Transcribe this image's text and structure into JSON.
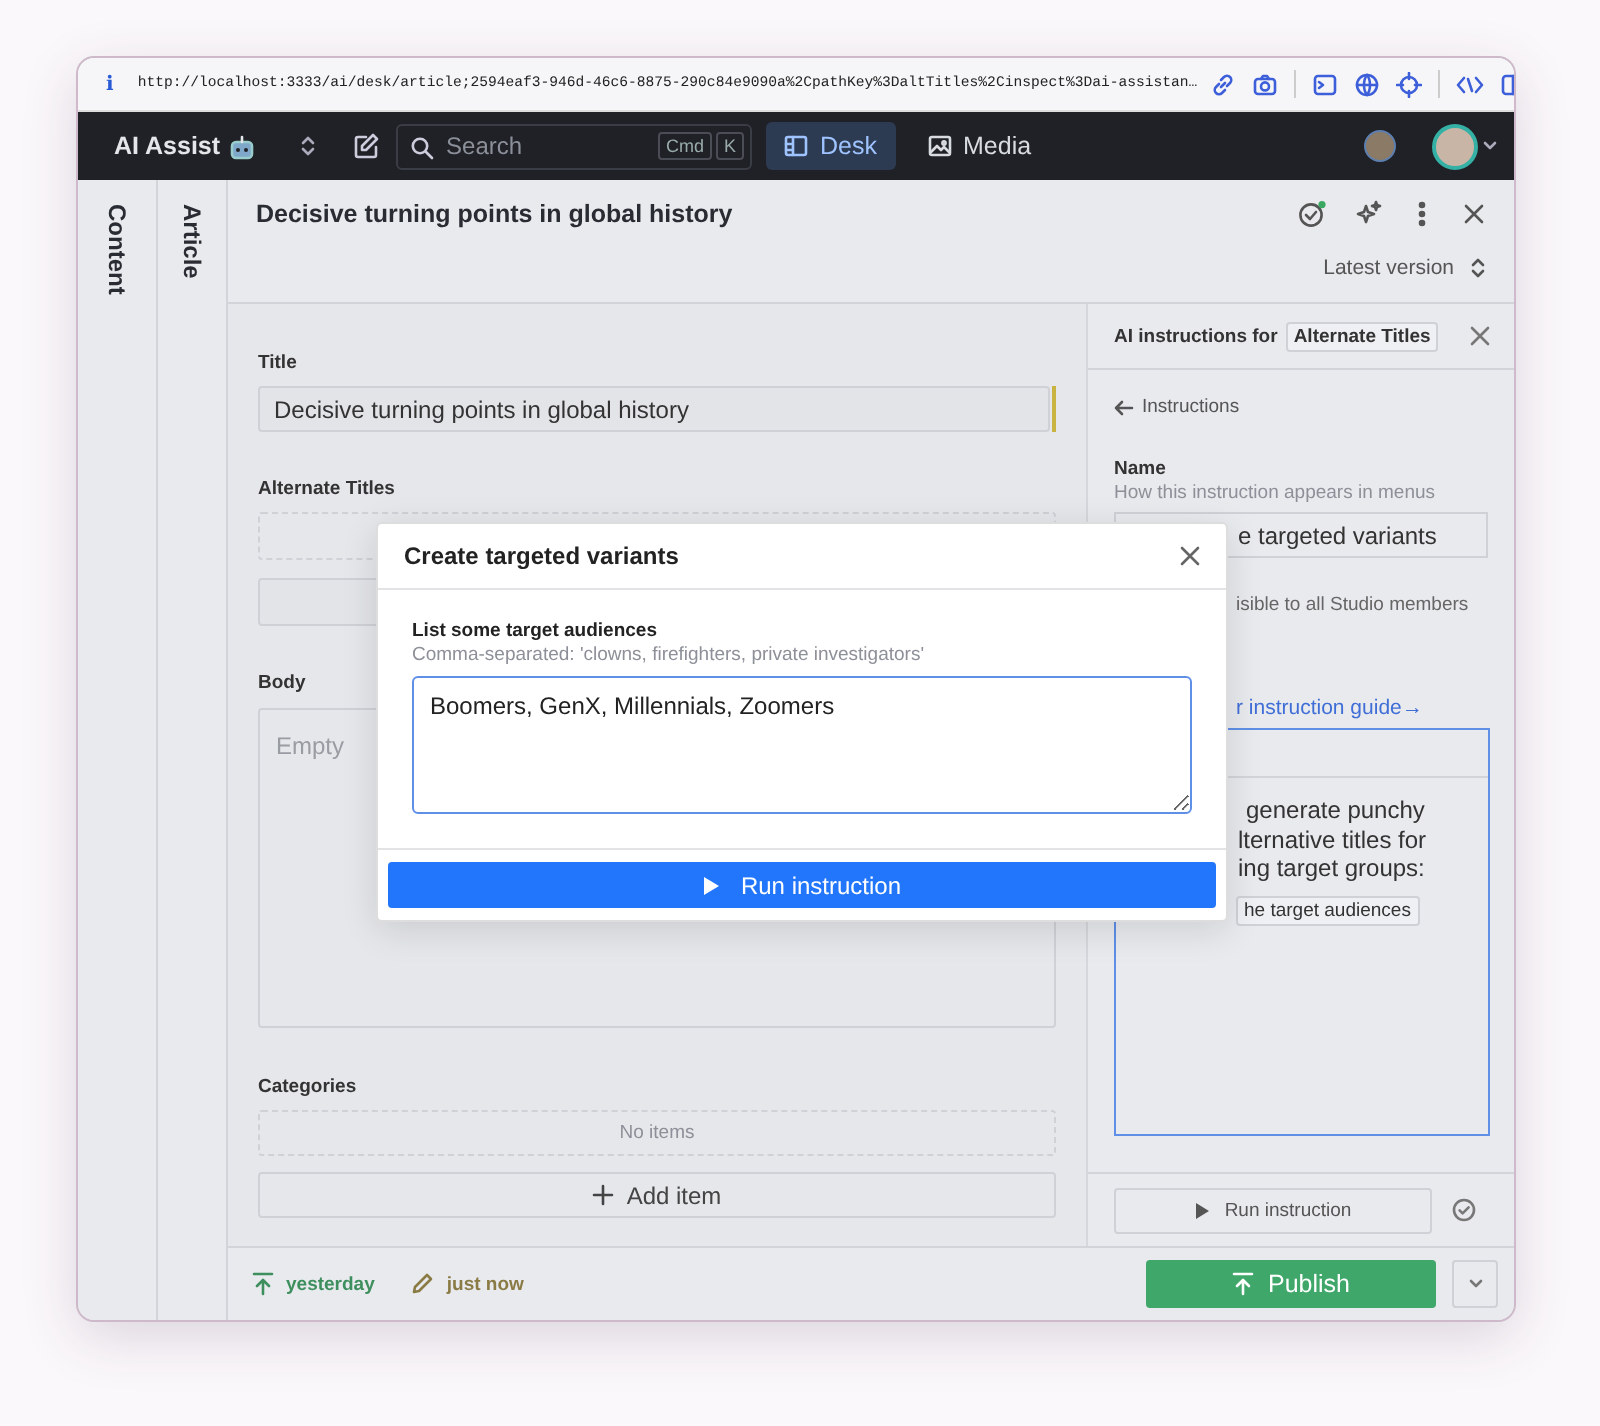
{
  "browser": {
    "info_icon": "i",
    "url": "http://localhost:3333/ai/desk/article;2594eaf3-946d-46c6-8875-290c84e9090a%2CpathKey%3DaltTitles%2Cinspect%3Dai-assistan…"
  },
  "navbar": {
    "app_name": "AI Assist",
    "search": {
      "placeholder": "Search",
      "shortcut": [
        "Cmd",
        "K"
      ]
    },
    "tabs": [
      {
        "label": "Desk",
        "selected": true
      },
      {
        "label": "Media",
        "selected": false
      }
    ]
  },
  "side_tabs": [
    {
      "label": "Content"
    },
    {
      "label": "Article"
    }
  ],
  "document": {
    "title": "Decisive turning points in global history",
    "version": "Latest version"
  },
  "form": {
    "title": {
      "label": "Title",
      "value": "Decisive turning points in global history",
      "changed": true
    },
    "alternate_titles": {
      "label": "Alternate Titles"
    },
    "body": {
      "label": "Body",
      "placeholder": "Empty"
    },
    "categories": {
      "label": "Categories",
      "empty_text": "No items",
      "add_button": "Add item"
    }
  },
  "ai_panel": {
    "heading": "AI instructions for",
    "field_badge": "Alternate Titles",
    "back_link": "Instructions",
    "name_label": "Name",
    "name_hint": "How this instruction appears in menus",
    "name_value": "e targeted variants",
    "visibility_text": "isible to all Studio members",
    "guide_link": "r instruction guide→",
    "prompt_lines": [
      "generate punchy",
      "lternative titles for",
      "ing target groups:"
    ],
    "prompt_chip": "he target audiences",
    "run_button": "Run instruction"
  },
  "footer": {
    "published": "yesterday",
    "edited": "just now",
    "publish_button": "Publish"
  },
  "modal": {
    "title": "Create targeted variants",
    "field_label": "List some target audiences",
    "field_hint": "Comma-separated: 'clowns, firefighters, private investigators'",
    "field_value": "Boomers, GenX, Millennials, Zoomers",
    "run_button": "Run instruction"
  }
}
